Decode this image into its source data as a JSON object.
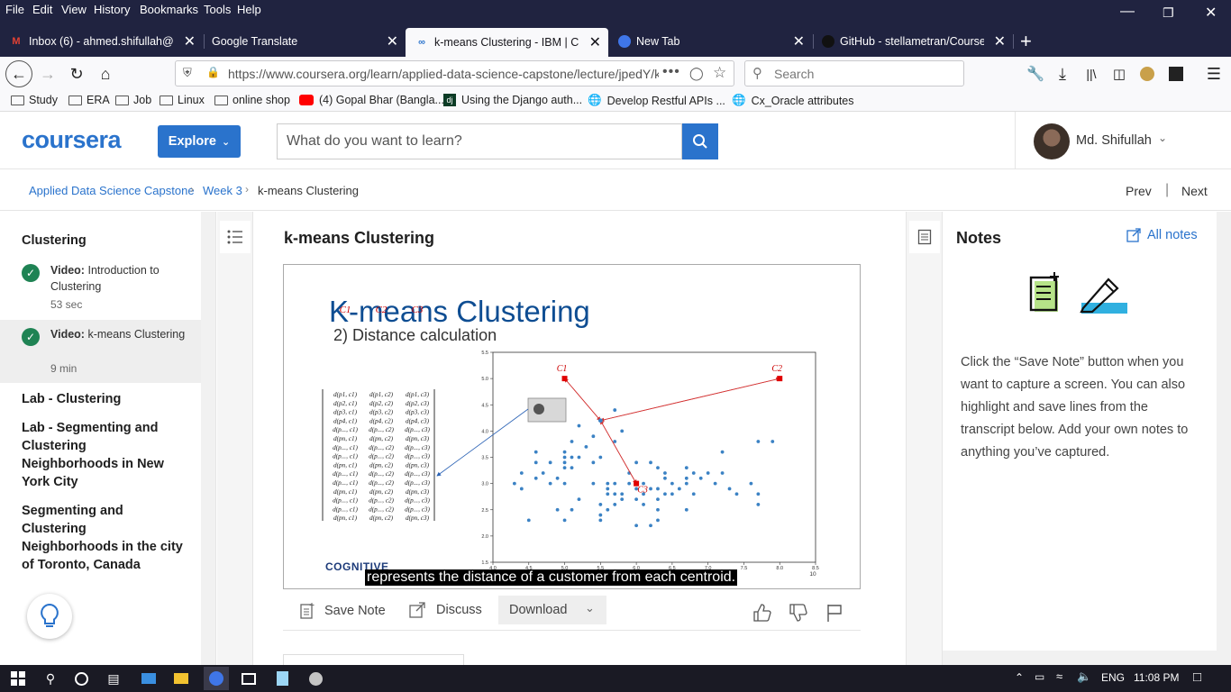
{
  "menu": [
    "File",
    "Edit",
    "View",
    "History",
    "Bookmarks",
    "Tools",
    "Help"
  ],
  "tabs": [
    {
      "label": "Inbox (6) - ahmed.shifullah@gr",
      "icon": "gmail-icon"
    },
    {
      "label": "Google Translate",
      "icon": "translate-icon"
    },
    {
      "label": "k-means Clustering - IBM | Cou",
      "icon": "coursera-icon"
    },
    {
      "label": "New Tab",
      "icon": "firefox-icon"
    },
    {
      "label": "GitHub - stellametran/Coursera",
      "icon": "github-icon"
    }
  ],
  "address": {
    "url": "https://www.coursera.org/learn/applied-data-science-capstone/lecture/jpedY/k",
    "search_placeholder": "Search"
  },
  "bookmarks": [
    "Study",
    "ERA",
    "Job",
    "Linux",
    "online shop",
    "(4) Gopal Bhar (Bangla...",
    "Using the Django auth...",
    "Develop Restful APIs ...",
    "Cx_Oracle attributes"
  ],
  "header": {
    "logo": "coursera",
    "explore": "Explore",
    "search_placeholder": "What do you want to learn?",
    "username": "Md. Shifullah"
  },
  "breadcrumb": [
    "Applied Data Science Capstone",
    "Week 3",
    "k-means Clustering"
  ],
  "nav": {
    "prev": "Prev",
    "next": "Next"
  },
  "sidebar": {
    "section": "Clustering",
    "items": [
      {
        "kind": "Video:",
        "title": "Introduction to Clustering",
        "duration": "53 sec"
      },
      {
        "kind": "Video:",
        "title": "k-means Clustering",
        "duration": "9 min"
      }
    ],
    "links": [
      "Lab - Clustering",
      "Lab - Segmenting and Clustering Neighborhoods in New York City",
      "Segmenting and Clustering Neighborhoods in the city of Toronto, Canada"
    ]
  },
  "main": {
    "title": "k-means Clustering",
    "slide_title": "K-means Clustering",
    "slide_subtitle": "2) Distance calculation",
    "caption": "represents the distance of a customer from each centroid.",
    "brand": "COGNITIVE",
    "matrix_header": [
      "C1",
      "C2",
      "C3"
    ],
    "matrix_rows": [
      [
        "d(p1, c1)",
        "d(p1, c2)",
        "d(p1, c3)"
      ],
      [
        "d(p2, c1)",
        "d(p2, c2)",
        "d(p2, c3)"
      ],
      [
        "d(p3, c1)",
        "d(p3, c2)",
        "d(p3, c3)"
      ],
      [
        "d(p4, c1)",
        "d(p4, c2)",
        "d(p4, c3)"
      ],
      [
        "d(p..., c1)",
        "d(p..., c2)",
        "d(p..., c3)"
      ],
      [
        "d(pn, c1)",
        "d(pn, c2)",
        "d(pn, c3)"
      ],
      [
        "d(p..., c1)",
        "d(p..., c2)",
        "d(p..., c3)"
      ],
      [
        "d(p..., c1)",
        "d(p..., c2)",
        "d(p..., c3)"
      ],
      [
        "d(pn, c1)",
        "d(pn, c2)",
        "d(pn, c3)"
      ],
      [
        "d(p..., c1)",
        "d(p..., c2)",
        "d(p..., c3)"
      ],
      [
        "d(p..., c1)",
        "d(p..., c2)",
        "d(p..., c3)"
      ],
      [
        "d(pn, c1)",
        "d(pn, c2)",
        "d(pn, c3)"
      ],
      [
        "d(p..., c1)",
        "d(p..., c2)",
        "d(p..., c3)"
      ],
      [
        "d(p..., c1)",
        "d(p..., c2)",
        "d(p..., c3)"
      ],
      [
        "d(pn, c1)",
        "d(pn, c2)",
        "d(pn, c3)"
      ]
    ],
    "actions": {
      "save_note": "Save Note",
      "discuss": "Discuss",
      "download": "Download"
    }
  },
  "chart_data": {
    "type": "scatter",
    "xlim": [
      4.0,
      8.5
    ],
    "ylim": [
      1.5,
      5.5
    ],
    "x_ticks": [
      "4.0",
      "4.5",
      "5.0",
      "5.5",
      "6.0",
      "6.5",
      "7.0",
      "7.5",
      "8.0",
      "8.5"
    ],
    "y_ticks": [
      "1.5",
      "2.0",
      "2.5",
      "3.0",
      "3.5",
      "4.0",
      "4.5",
      "5.0",
      "5.5"
    ],
    "x_axis_extra": "10",
    "points": [
      [
        4.3,
        3.0
      ],
      [
        4.4,
        2.9
      ],
      [
        4.4,
        3.2
      ],
      [
        4.5,
        2.3
      ],
      [
        4.6,
        3.1
      ],
      [
        4.6,
        3.6
      ],
      [
        4.6,
        3.4
      ],
      [
        4.7,
        3.2
      ],
      [
        4.8,
        3.0
      ],
      [
        4.8,
        3.4
      ],
      [
        4.9,
        3.1
      ],
      [
        4.9,
        2.5
      ],
      [
        5.0,
        3.6
      ],
      [
        5.0,
        3.4
      ],
      [
        5.0,
        3.0
      ],
      [
        5.0,
        2.3
      ],
      [
        5.0,
        3.5
      ],
      [
        5.0,
        3.3
      ],
      [
        5.1,
        3.5
      ],
      [
        5.1,
        3.8
      ],
      [
        5.1,
        3.3
      ],
      [
        5.1,
        2.5
      ],
      [
        5.2,
        3.5
      ],
      [
        5.2,
        4.1
      ],
      [
        5.2,
        2.7
      ],
      [
        5.3,
        3.7
      ],
      [
        5.4,
        3.9
      ],
      [
        5.4,
        3.4
      ],
      [
        5.4,
        3.0
      ],
      [
        5.5,
        4.2
      ],
      [
        5.5,
        3.5
      ],
      [
        5.5,
        2.4
      ],
      [
        5.5,
        2.6
      ],
      [
        5.5,
        2.3
      ],
      [
        5.6,
        3.0
      ],
      [
        5.6,
        2.9
      ],
      [
        5.6,
        2.8
      ],
      [
        5.6,
        2.5
      ],
      [
        5.7,
        4.4
      ],
      [
        5.7,
        3.8
      ],
      [
        5.7,
        2.8
      ],
      [
        5.7,
        3.0
      ],
      [
        5.7,
        2.6
      ],
      [
        5.8,
        4.0
      ],
      [
        5.8,
        2.7
      ],
      [
        5.8,
        2.8
      ],
      [
        5.9,
        3.0
      ],
      [
        5.9,
        3.2
      ],
      [
        6.0,
        2.2
      ],
      [
        6.0,
        2.9
      ],
      [
        6.0,
        3.4
      ],
      [
        6.0,
        2.7
      ],
      [
        6.1,
        3.0
      ],
      [
        6.1,
        2.8
      ],
      [
        6.1,
        2.6
      ],
      [
        6.2,
        2.2
      ],
      [
        6.2,
        3.4
      ],
      [
        6.2,
        2.9
      ],
      [
        6.3,
        3.3
      ],
      [
        6.3,
        2.7
      ],
      [
        6.3,
        2.5
      ],
      [
        6.3,
        2.3
      ],
      [
        6.3,
        2.9
      ],
      [
        6.4,
        3.2
      ],
      [
        6.4,
        2.8
      ],
      [
        6.4,
        3.1
      ],
      [
        6.5,
        3.0
      ],
      [
        6.5,
        2.8
      ],
      [
        6.6,
        2.9
      ],
      [
        6.7,
        3.1
      ],
      [
        6.7,
        3.3
      ],
      [
        6.7,
        2.5
      ],
      [
        6.7,
        3.0
      ],
      [
        6.8,
        2.8
      ],
      [
        6.8,
        3.2
      ],
      [
        6.9,
        3.1
      ],
      [
        7.0,
        3.2
      ],
      [
        7.1,
        3.0
      ],
      [
        7.2,
        3.6
      ],
      [
        7.2,
        3.2
      ],
      [
        7.3,
        2.9
      ],
      [
        7.4,
        2.8
      ],
      [
        7.6,
        3.0
      ],
      [
        7.7,
        3.8
      ],
      [
        7.7,
        2.6
      ],
      [
        7.7,
        2.8
      ],
      [
        7.9,
        3.8
      ]
    ],
    "centroids": [
      {
        "label": "C1",
        "x": 5.0,
        "y": 5.0
      },
      {
        "label": "C2",
        "x": 8.0,
        "y": 5.0
      },
      {
        "label": "C3",
        "x": 6.0,
        "y": 3.0
      }
    ],
    "highlight_point": {
      "x": 5.5,
      "y": 4.2
    },
    "colors": {
      "points": "#3b82c4",
      "centroids": "#e00000",
      "arrows": "#d33333"
    }
  },
  "notes": {
    "title": "Notes",
    "all_notes": "All notes",
    "text": "Click the “Save Note” button when you want to capture a screen. You can also highlight and save lines from the transcript below. Add your own notes to anything you’ve captured."
  },
  "taskbar": {
    "lang": "ENG",
    "time": "11:08 PM"
  }
}
